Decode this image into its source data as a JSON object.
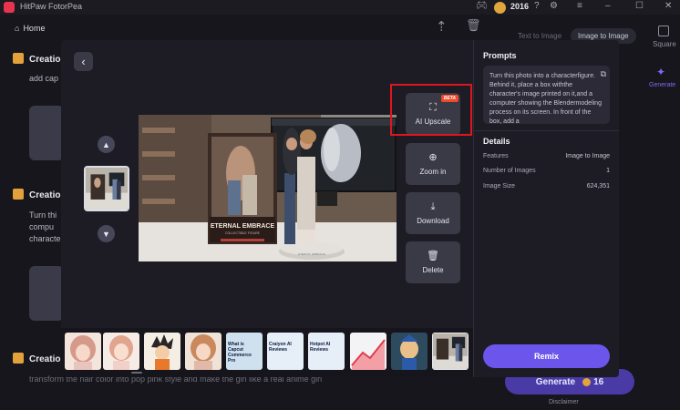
{
  "app": {
    "name": "HitPaw FotorPea",
    "credits": "2016"
  },
  "nav": {
    "home_label": "Home"
  },
  "background": {
    "cards": [
      {
        "title": "Creatio",
        "text": "add cap"
      },
      {
        "title": "Creatio",
        "text_lines": [
          "Turn thi",
          "compu",
          "characte"
        ]
      },
      {
        "title": "Creatio",
        "text": "transform the hair color into pop pink style and make the girl like a real anime girl"
      }
    ],
    "tabs": {
      "text_to_image": "Text to Image",
      "image_to_image": "Image to Image"
    },
    "square_label": "Square",
    "generate_side_label": "Generate",
    "generate_button": {
      "label": "Generate",
      "cost": "16"
    },
    "disclaimer": "Disclaimer"
  },
  "modal": {
    "actions": {
      "upscale": {
        "label": "AI Upscale",
        "badge": "BETA",
        "icon": "expand-icon"
      },
      "zoom": {
        "label": "Zoom in",
        "icon": "zoom-in-icon"
      },
      "download": {
        "label": "Download",
        "icon": "download-icon"
      },
      "delete": {
        "label": "Delete",
        "icon": "trash-icon"
      }
    },
    "photo": {
      "box_title": "ETERNAL EMBRACE",
      "box_subtitle": "COLLECTIBLE FIGURE",
      "base_text": "ETERNAL EMBRACE"
    },
    "side": {
      "prompts_title": "Prompts",
      "prompt_text": "Turn this photo into a characterfigure. Behind it, place a box withthe character's image printed on it,and a computer showing the Blendermodeling process on its screen. In front of the box, add a",
      "details_title": "Details",
      "details": [
        {
          "label": "Features",
          "value": "Image to Image"
        },
        {
          "label": "Number of Images",
          "value": "1"
        },
        {
          "label": "Image Size",
          "value": "624,351"
        }
      ]
    },
    "remix_label": "Remix",
    "strip": {
      "items": [
        {
          "kind": "anime"
        },
        {
          "kind": "anime"
        },
        {
          "kind": "anime-boy"
        },
        {
          "kind": "anime"
        },
        {
          "kind": "text",
          "text": "What is Capcut Commerce Pro"
        },
        {
          "kind": "text",
          "text": "Craiyon AI Reviews"
        },
        {
          "kind": "text",
          "text": "Hotpot AI Reviews"
        },
        {
          "kind": "chart"
        },
        {
          "kind": "game"
        },
        {
          "kind": "photo",
          "selected": true
        }
      ]
    }
  }
}
